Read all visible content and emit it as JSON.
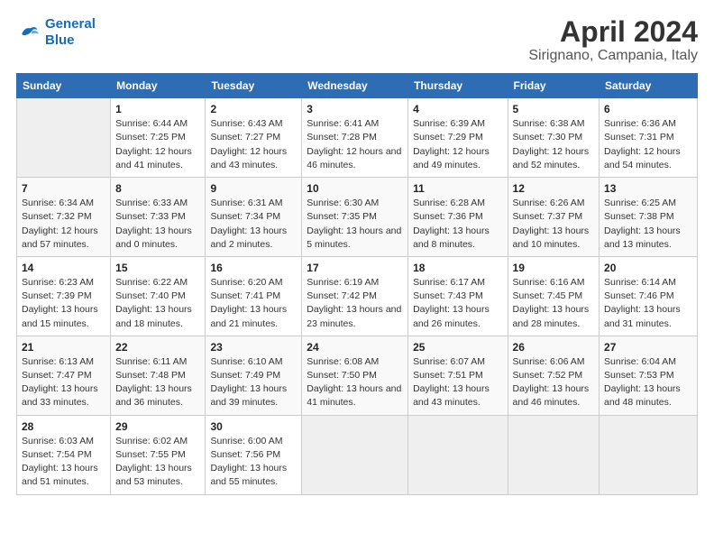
{
  "header": {
    "logo_line1": "General",
    "logo_line2": "Blue",
    "title": "April 2024",
    "subtitle": "Sirignano, Campania, Italy"
  },
  "columns": [
    "Sunday",
    "Monday",
    "Tuesday",
    "Wednesday",
    "Thursday",
    "Friday",
    "Saturday"
  ],
  "rows": [
    [
      {
        "day": "",
        "sunrise": "",
        "sunset": "",
        "daylight": ""
      },
      {
        "day": "1",
        "sunrise": "Sunrise: 6:44 AM",
        "sunset": "Sunset: 7:25 PM",
        "daylight": "Daylight: 12 hours and 41 minutes."
      },
      {
        "day": "2",
        "sunrise": "Sunrise: 6:43 AM",
        "sunset": "Sunset: 7:27 PM",
        "daylight": "Daylight: 12 hours and 43 minutes."
      },
      {
        "day": "3",
        "sunrise": "Sunrise: 6:41 AM",
        "sunset": "Sunset: 7:28 PM",
        "daylight": "Daylight: 12 hours and 46 minutes."
      },
      {
        "day": "4",
        "sunrise": "Sunrise: 6:39 AM",
        "sunset": "Sunset: 7:29 PM",
        "daylight": "Daylight: 12 hours and 49 minutes."
      },
      {
        "day": "5",
        "sunrise": "Sunrise: 6:38 AM",
        "sunset": "Sunset: 7:30 PM",
        "daylight": "Daylight: 12 hours and 52 minutes."
      },
      {
        "day": "6",
        "sunrise": "Sunrise: 6:36 AM",
        "sunset": "Sunset: 7:31 PM",
        "daylight": "Daylight: 12 hours and 54 minutes."
      }
    ],
    [
      {
        "day": "7",
        "sunrise": "Sunrise: 6:34 AM",
        "sunset": "Sunset: 7:32 PM",
        "daylight": "Daylight: 12 hours and 57 minutes."
      },
      {
        "day": "8",
        "sunrise": "Sunrise: 6:33 AM",
        "sunset": "Sunset: 7:33 PM",
        "daylight": "Daylight: 13 hours and 0 minutes."
      },
      {
        "day": "9",
        "sunrise": "Sunrise: 6:31 AM",
        "sunset": "Sunset: 7:34 PM",
        "daylight": "Daylight: 13 hours and 2 minutes."
      },
      {
        "day": "10",
        "sunrise": "Sunrise: 6:30 AM",
        "sunset": "Sunset: 7:35 PM",
        "daylight": "Daylight: 13 hours and 5 minutes."
      },
      {
        "day": "11",
        "sunrise": "Sunrise: 6:28 AM",
        "sunset": "Sunset: 7:36 PM",
        "daylight": "Daylight: 13 hours and 8 minutes."
      },
      {
        "day": "12",
        "sunrise": "Sunrise: 6:26 AM",
        "sunset": "Sunset: 7:37 PM",
        "daylight": "Daylight: 13 hours and 10 minutes."
      },
      {
        "day": "13",
        "sunrise": "Sunrise: 6:25 AM",
        "sunset": "Sunset: 7:38 PM",
        "daylight": "Daylight: 13 hours and 13 minutes."
      }
    ],
    [
      {
        "day": "14",
        "sunrise": "Sunrise: 6:23 AM",
        "sunset": "Sunset: 7:39 PM",
        "daylight": "Daylight: 13 hours and 15 minutes."
      },
      {
        "day": "15",
        "sunrise": "Sunrise: 6:22 AM",
        "sunset": "Sunset: 7:40 PM",
        "daylight": "Daylight: 13 hours and 18 minutes."
      },
      {
        "day": "16",
        "sunrise": "Sunrise: 6:20 AM",
        "sunset": "Sunset: 7:41 PM",
        "daylight": "Daylight: 13 hours and 21 minutes."
      },
      {
        "day": "17",
        "sunrise": "Sunrise: 6:19 AM",
        "sunset": "Sunset: 7:42 PM",
        "daylight": "Daylight: 13 hours and 23 minutes."
      },
      {
        "day": "18",
        "sunrise": "Sunrise: 6:17 AM",
        "sunset": "Sunset: 7:43 PM",
        "daylight": "Daylight: 13 hours and 26 minutes."
      },
      {
        "day": "19",
        "sunrise": "Sunrise: 6:16 AM",
        "sunset": "Sunset: 7:45 PM",
        "daylight": "Daylight: 13 hours and 28 minutes."
      },
      {
        "day": "20",
        "sunrise": "Sunrise: 6:14 AM",
        "sunset": "Sunset: 7:46 PM",
        "daylight": "Daylight: 13 hours and 31 minutes."
      }
    ],
    [
      {
        "day": "21",
        "sunrise": "Sunrise: 6:13 AM",
        "sunset": "Sunset: 7:47 PM",
        "daylight": "Daylight: 13 hours and 33 minutes."
      },
      {
        "day": "22",
        "sunrise": "Sunrise: 6:11 AM",
        "sunset": "Sunset: 7:48 PM",
        "daylight": "Daylight: 13 hours and 36 minutes."
      },
      {
        "day": "23",
        "sunrise": "Sunrise: 6:10 AM",
        "sunset": "Sunset: 7:49 PM",
        "daylight": "Daylight: 13 hours and 39 minutes."
      },
      {
        "day": "24",
        "sunrise": "Sunrise: 6:08 AM",
        "sunset": "Sunset: 7:50 PM",
        "daylight": "Daylight: 13 hours and 41 minutes."
      },
      {
        "day": "25",
        "sunrise": "Sunrise: 6:07 AM",
        "sunset": "Sunset: 7:51 PM",
        "daylight": "Daylight: 13 hours and 43 minutes."
      },
      {
        "day": "26",
        "sunrise": "Sunrise: 6:06 AM",
        "sunset": "Sunset: 7:52 PM",
        "daylight": "Daylight: 13 hours and 46 minutes."
      },
      {
        "day": "27",
        "sunrise": "Sunrise: 6:04 AM",
        "sunset": "Sunset: 7:53 PM",
        "daylight": "Daylight: 13 hours and 48 minutes."
      }
    ],
    [
      {
        "day": "28",
        "sunrise": "Sunrise: 6:03 AM",
        "sunset": "Sunset: 7:54 PM",
        "daylight": "Daylight: 13 hours and 51 minutes."
      },
      {
        "day": "29",
        "sunrise": "Sunrise: 6:02 AM",
        "sunset": "Sunset: 7:55 PM",
        "daylight": "Daylight: 13 hours and 53 minutes."
      },
      {
        "day": "30",
        "sunrise": "Sunrise: 6:00 AM",
        "sunset": "Sunset: 7:56 PM",
        "daylight": "Daylight: 13 hours and 55 minutes."
      },
      {
        "day": "",
        "sunrise": "",
        "sunset": "",
        "daylight": ""
      },
      {
        "day": "",
        "sunrise": "",
        "sunset": "",
        "daylight": ""
      },
      {
        "day": "",
        "sunrise": "",
        "sunset": "",
        "daylight": ""
      },
      {
        "day": "",
        "sunrise": "",
        "sunset": "",
        "daylight": ""
      }
    ]
  ]
}
